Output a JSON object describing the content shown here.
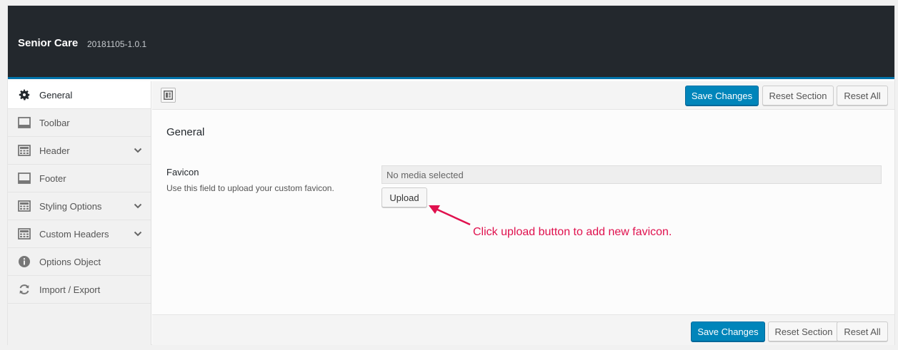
{
  "header": {
    "title": "Senior Care",
    "version": "20181105-1.0.1"
  },
  "sidebar": {
    "items": [
      {
        "label": "General",
        "icon": "gear-icon",
        "has_submenu": false,
        "active": true
      },
      {
        "label": "Toolbar",
        "icon": "panel-icon",
        "has_submenu": false,
        "active": false
      },
      {
        "label": "Header",
        "icon": "grid-panel-icon",
        "has_submenu": true,
        "active": false
      },
      {
        "label": "Footer",
        "icon": "panel-icon",
        "has_submenu": false,
        "active": false
      },
      {
        "label": "Styling Options",
        "icon": "grid-panel-icon",
        "has_submenu": true,
        "active": false
      },
      {
        "label": "Custom Headers",
        "icon": "grid-panel-icon",
        "has_submenu": true,
        "active": false
      },
      {
        "label": "Options Object",
        "icon": "info-icon",
        "has_submenu": false,
        "active": false
      },
      {
        "label": "Import / Export",
        "icon": "refresh-icon",
        "has_submenu": false,
        "active": false
      }
    ]
  },
  "toolbar": {
    "save_label": "Save Changes",
    "reset_section_label": "Reset Section",
    "reset_all_label": "Reset All"
  },
  "section": {
    "title": "General",
    "field": {
      "label": "Favicon",
      "description": "Use this field to upload your custom favicon.",
      "value": "No media selected",
      "upload_label": "Upload"
    }
  },
  "annotation": {
    "text": "Click upload button to add new favicon."
  },
  "footer": {
    "save_label": "Save Changes",
    "reset_section_label": "Reset Section",
    "reset_all_label": "Reset All"
  },
  "colors": {
    "header_bg": "#23282d",
    "accent": "#0073aa",
    "primary_button": "#0085ba",
    "annotation": "#e0114e"
  }
}
